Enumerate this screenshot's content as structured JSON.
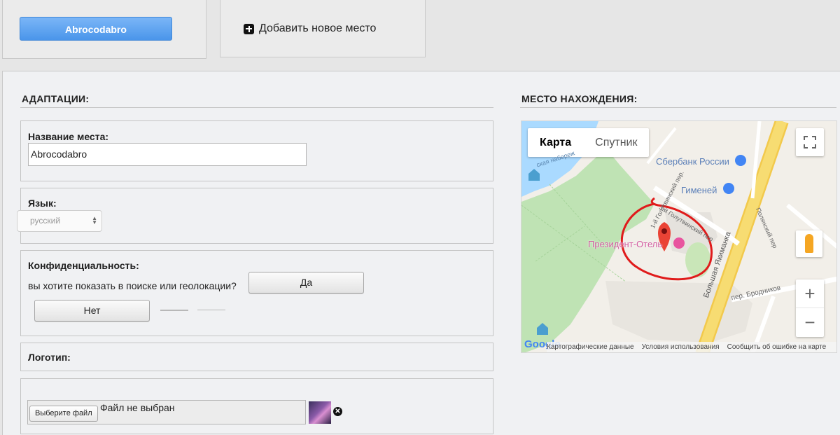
{
  "top": {
    "venue_button": "Abrocodabro",
    "add_place_label": "Добавить новое место"
  },
  "adaptations": {
    "title": "АДАПТАЦИИ:",
    "place_name_label": "Название места:",
    "place_name_value": "Abrocodabro",
    "language_label": "Язык:",
    "language_value": "русский",
    "privacy_label": "Конфиденциальность:",
    "privacy_question": "вы хотите показать в поиске или геолокации?",
    "yes_button": "Да",
    "no_button": "Нет",
    "logo_label": "Логотип:",
    "choose_file_button": "Выберите файл",
    "file_status": "Файл не выбран",
    "remove_icon_glyph": "✕"
  },
  "location": {
    "title": "МЕСТО НАХОЖДЕНИЯ:",
    "map": {
      "tabs": [
        "Карта",
        "Спутник"
      ],
      "active_tab": "Карта",
      "labels": {
        "sberbank": "Сбербанк России",
        "gimenei": "Гименей",
        "hotel": "Президент-Отель",
        "street_yakimanka": "Большая Якиманка",
        "street_brodnikov": "пер. Бродников",
        "street_golutvinsky": "3-й Голутвинский пер",
        "street_golutvinsky_1": "1-й Голутвинский пер.",
        "street_polyansky": "Полянский пер",
        "embankment": "ская набереж"
      },
      "zoom_in": "+",
      "zoom_out": "−",
      "attribution": [
        "Картографические данные",
        "Условия использования",
        "Сообщить об ошибке на карте"
      ],
      "google_logo": "Google",
      "colors": {
        "land": "#f2efe9",
        "park": "#bfe3b4",
        "water": "#aadaff",
        "major_road": "#f7dc72",
        "pin": "#ea4335",
        "hotel_label": "#d25ca0",
        "annotation": "#e01b1b"
      }
    }
  }
}
